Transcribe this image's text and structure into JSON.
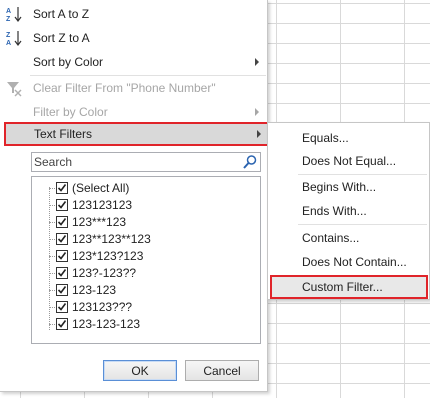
{
  "menu": {
    "sort_az": "Sort A to Z",
    "sort_za": "Sort Z to A",
    "sort_color": "Sort by Color",
    "clear_filter": "Clear Filter From \"Phone Number\"",
    "filter_color": "Filter by Color",
    "text_filters": "Text Filters"
  },
  "search": {
    "placeholder": "Search"
  },
  "list": {
    "items": [
      {
        "label": "(Select All)",
        "checked": true
      },
      {
        "label": "123123123",
        "checked": true
      },
      {
        "label": "123***123",
        "checked": true
      },
      {
        "label": "123**123**123",
        "checked": true
      },
      {
        "label": "123*123?123",
        "checked": true
      },
      {
        "label": "123?-123??",
        "checked": true
      },
      {
        "label": "123-123",
        "checked": true
      },
      {
        "label": "123123???",
        "checked": true
      },
      {
        "label": "123-123-123",
        "checked": true
      }
    ]
  },
  "buttons": {
    "ok": "OK",
    "cancel": "Cancel"
  },
  "submenu": {
    "equals": "Equals...",
    "does_not_equal": "Does Not Equal...",
    "begins_with": "Begins With...",
    "ends_with": "Ends With...",
    "contains": "Contains...",
    "does_not_contain": "Does Not Contain...",
    "custom_filter": "Custom Filter..."
  },
  "colors": {
    "highlight_border": "#e0242a",
    "accent_blue": "#2b64b0"
  }
}
